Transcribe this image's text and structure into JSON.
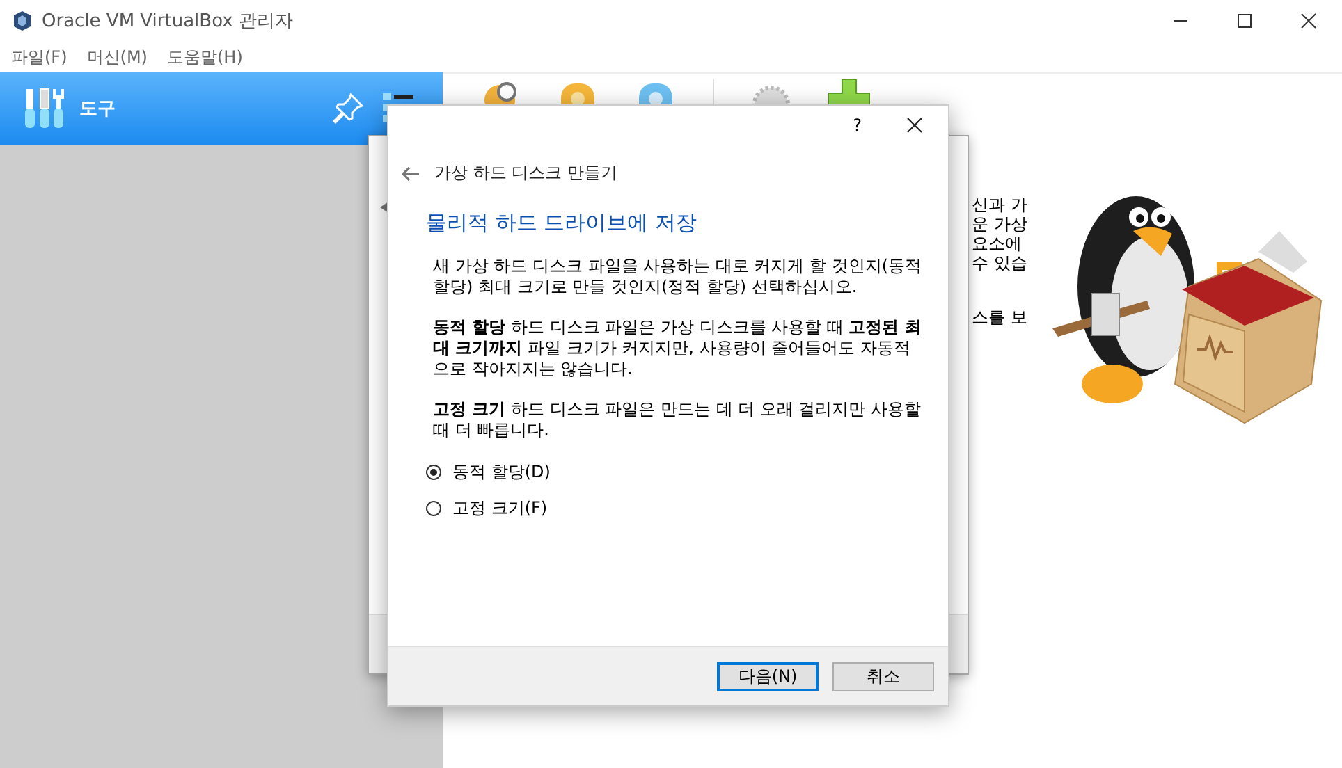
{
  "window": {
    "title": "Oracle VM VirtualBox 관리자"
  },
  "menu": [
    {
      "label": "파일(F)"
    },
    {
      "label": "머신(M)"
    },
    {
      "label": "도움말(H)"
    }
  ],
  "sidebar": {
    "items": [
      {
        "label": "도구",
        "selected": true
      }
    ]
  },
  "welcome_fragments": [
    "신과 가",
    "운 가상",
    "요소에",
    "수 있습",
    "스를 보"
  ],
  "dialog": {
    "help": "?",
    "title": "가상 하드 디스크 만들기",
    "heading": "물리적 하드 드라이브에 저장",
    "paragraphs": [
      "새 가상 하드 디스크 파일을 사용하는 대로 커지게 할 것인지(동적 할당) 최대 크기로 만들 것인지(정적 할당) 선택하십시오.",
      "**동적 할당** 하드 디스크 파일은 가상 디스크를 사용할 때 **고정된 최대 크기까지** 파일 크기가 커지지만, 사용량이 줄어들어도 자동적으로 작아지지는 않습니다.",
      "**고정 크기** 하드 디스크 파일은 만드는 데 더 오래 걸리지만 사용할 때 더 빠릅니다."
    ],
    "options": [
      {
        "label": "동적 할당(D)",
        "selected": true
      },
      {
        "label": "고정 크기(F)",
        "selected": false
      }
    ],
    "buttons": [
      {
        "label": "다음(N)",
        "default": true
      },
      {
        "label": "취소",
        "default": false
      }
    ]
  }
}
